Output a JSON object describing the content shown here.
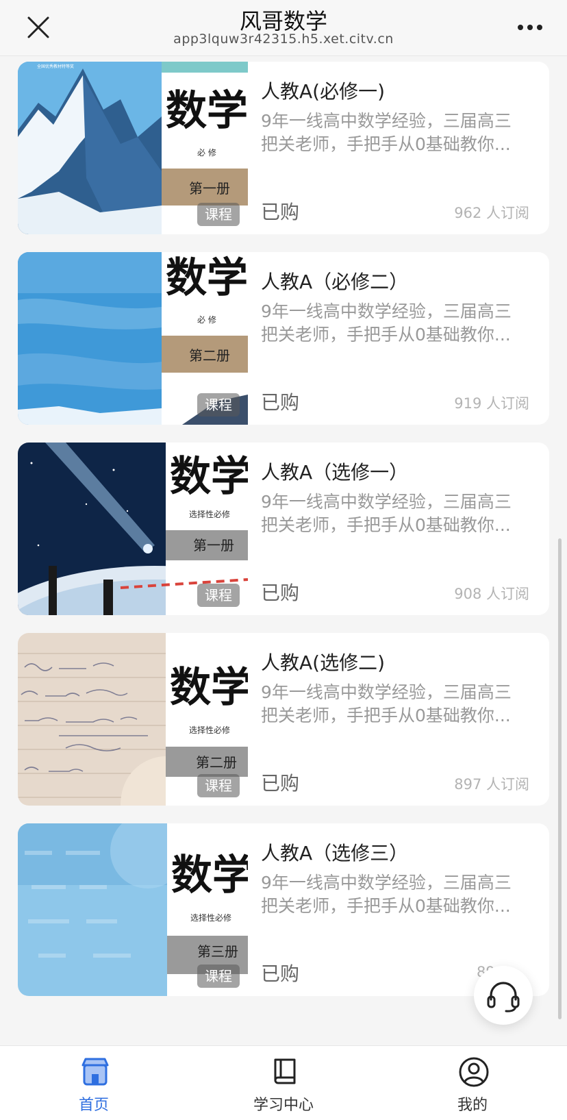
{
  "header": {
    "title": "风哥数学",
    "url": "app3lquw3r42315.h5.xet.citv.cn",
    "close_icon": "close-icon",
    "more_icon": "more-icon"
  },
  "courses": [
    {
      "title": "人教A(必修一)",
      "desc_line1": "9年一线高中数学经验，三届高三",
      "desc_line2": "把关老师，手把手从0基础教你...",
      "status": "已购",
      "subscribers": "962 人订阅",
      "badge": "课程",
      "cover": {
        "series": "全国优秀教材特等奖",
        "big": "数学",
        "level": "必 修",
        "volume": "第一册"
      }
    },
    {
      "title": "人教A（必修二）",
      "desc_line1": "9年一线高中数学经验，三届高三",
      "desc_line2": "把关老师，手把手从0基础教你...",
      "status": "已购",
      "subscribers": "919 人订阅",
      "badge": "课程",
      "cover": {
        "big": "数学",
        "level": "必 修",
        "volume": "第二册"
      }
    },
    {
      "title": "人教A（选修一）",
      "desc_line1": "9年一线高中数学经验，三届高三",
      "desc_line2": "把关老师，手把手从0基础教你...",
      "status": "已购",
      "subscribers": "908 人订阅",
      "badge": "课程",
      "cover": {
        "big": "数学",
        "level": "选择性必修",
        "volume": "第一册"
      }
    },
    {
      "title": "人教A(选修二)",
      "desc_line1": "9年一线高中数学经验，三届高三",
      "desc_line2": "把关老师，手把手从0基础教你...",
      "status": "已购",
      "subscribers": "897 人订阅",
      "badge": "课程",
      "cover": {
        "big": "数学",
        "level": "选择性必修",
        "volume": "第二册"
      }
    },
    {
      "title": "人教A（选修三）",
      "desc_line1": "9年一线高中数学经验，三届高三",
      "desc_line2": "把关老师，手把手从0基础教你...",
      "status": "已购",
      "subscribers": "89",
      "subscribers_suffix": "阅",
      "badge": "课程",
      "cover": {
        "big": "数学",
        "level": "选择性必修",
        "volume": "第三册"
      }
    }
  ],
  "support": {
    "icon": "headset-icon"
  },
  "tabbar": {
    "tabs": [
      {
        "label": "首页",
        "icon": "home-icon",
        "active": true
      },
      {
        "label": "学习中心",
        "icon": "book-icon",
        "active": false
      },
      {
        "label": "我的",
        "icon": "user-icon",
        "active": false
      }
    ]
  },
  "colors": {
    "accent": "#2f6fe0",
    "muted": "#999999",
    "background": "#f5f5f5"
  }
}
